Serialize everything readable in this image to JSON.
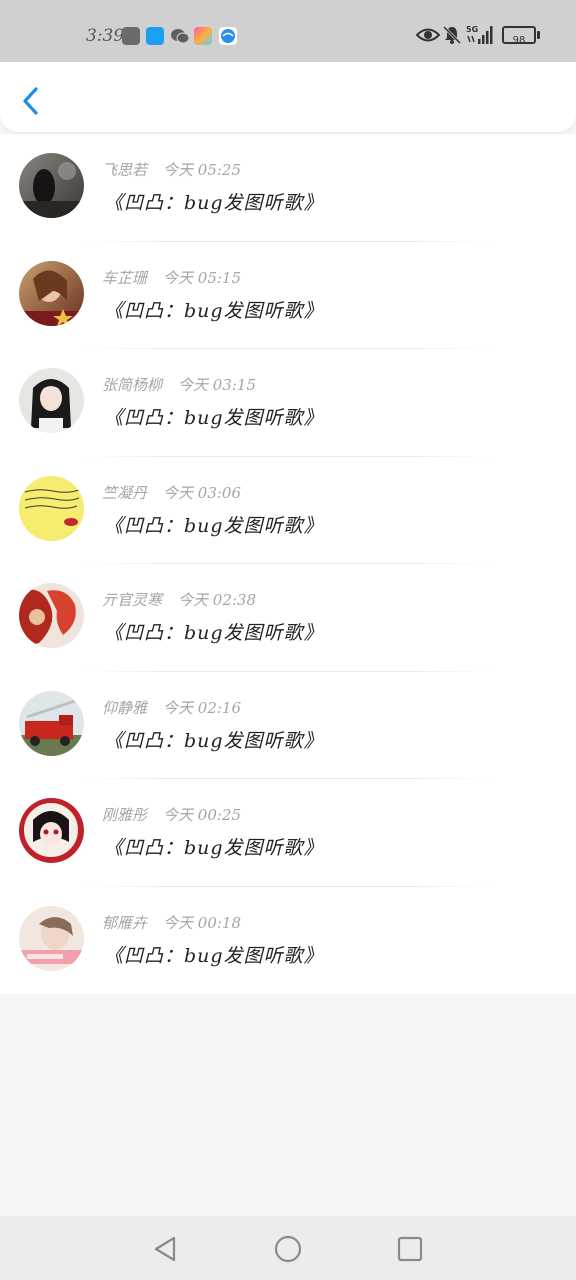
{
  "status_bar": {
    "time": "3:39",
    "battery": "98",
    "network": "5G",
    "icons": [
      "huawei-app-icon",
      "search-app-icon",
      "wechat-icon",
      "photos-app-icon",
      "browser-app-icon",
      "eye-icon",
      "bell-muted-icon",
      "signal-icon",
      "battery-icon"
    ]
  },
  "header": {
    "back_icon": "chevron-left-icon",
    "accent_color": "#1e8fe0"
  },
  "messages": [
    {
      "name": "飞思若",
      "time": "今天 05:25",
      "text": "《凹凸：bug发图听歌》"
    },
    {
      "name": "车芷珊",
      "time": "今天 05:15",
      "text": "《凹凸：bug发图听歌》"
    },
    {
      "name": "张简杨柳",
      "time": "今天 03:15",
      "text": "《凹凸：bug发图听歌》"
    },
    {
      "name": "竺凝丹",
      "time": "今天 03:06",
      "text": "《凹凸：bug发图听歌》"
    },
    {
      "name": "亓官灵寒",
      "time": "今天 02:38",
      "text": "《凹凸：bug发图听歌》"
    },
    {
      "name": "仰静雅",
      "time": "今天 02:16",
      "text": "《凹凸：bug发图听歌》"
    },
    {
      "name": "刚雅彤",
      "time": "今天 00:25",
      "text": "《凹凸：bug发图听歌》"
    },
    {
      "name": "郁雁卉",
      "time": "今天 00:18",
      "text": "《凹凸：bug发图听歌》"
    }
  ],
  "nav_bar": {
    "icons": [
      "back-triangle-icon",
      "home-circle-icon",
      "recents-square-icon"
    ]
  }
}
